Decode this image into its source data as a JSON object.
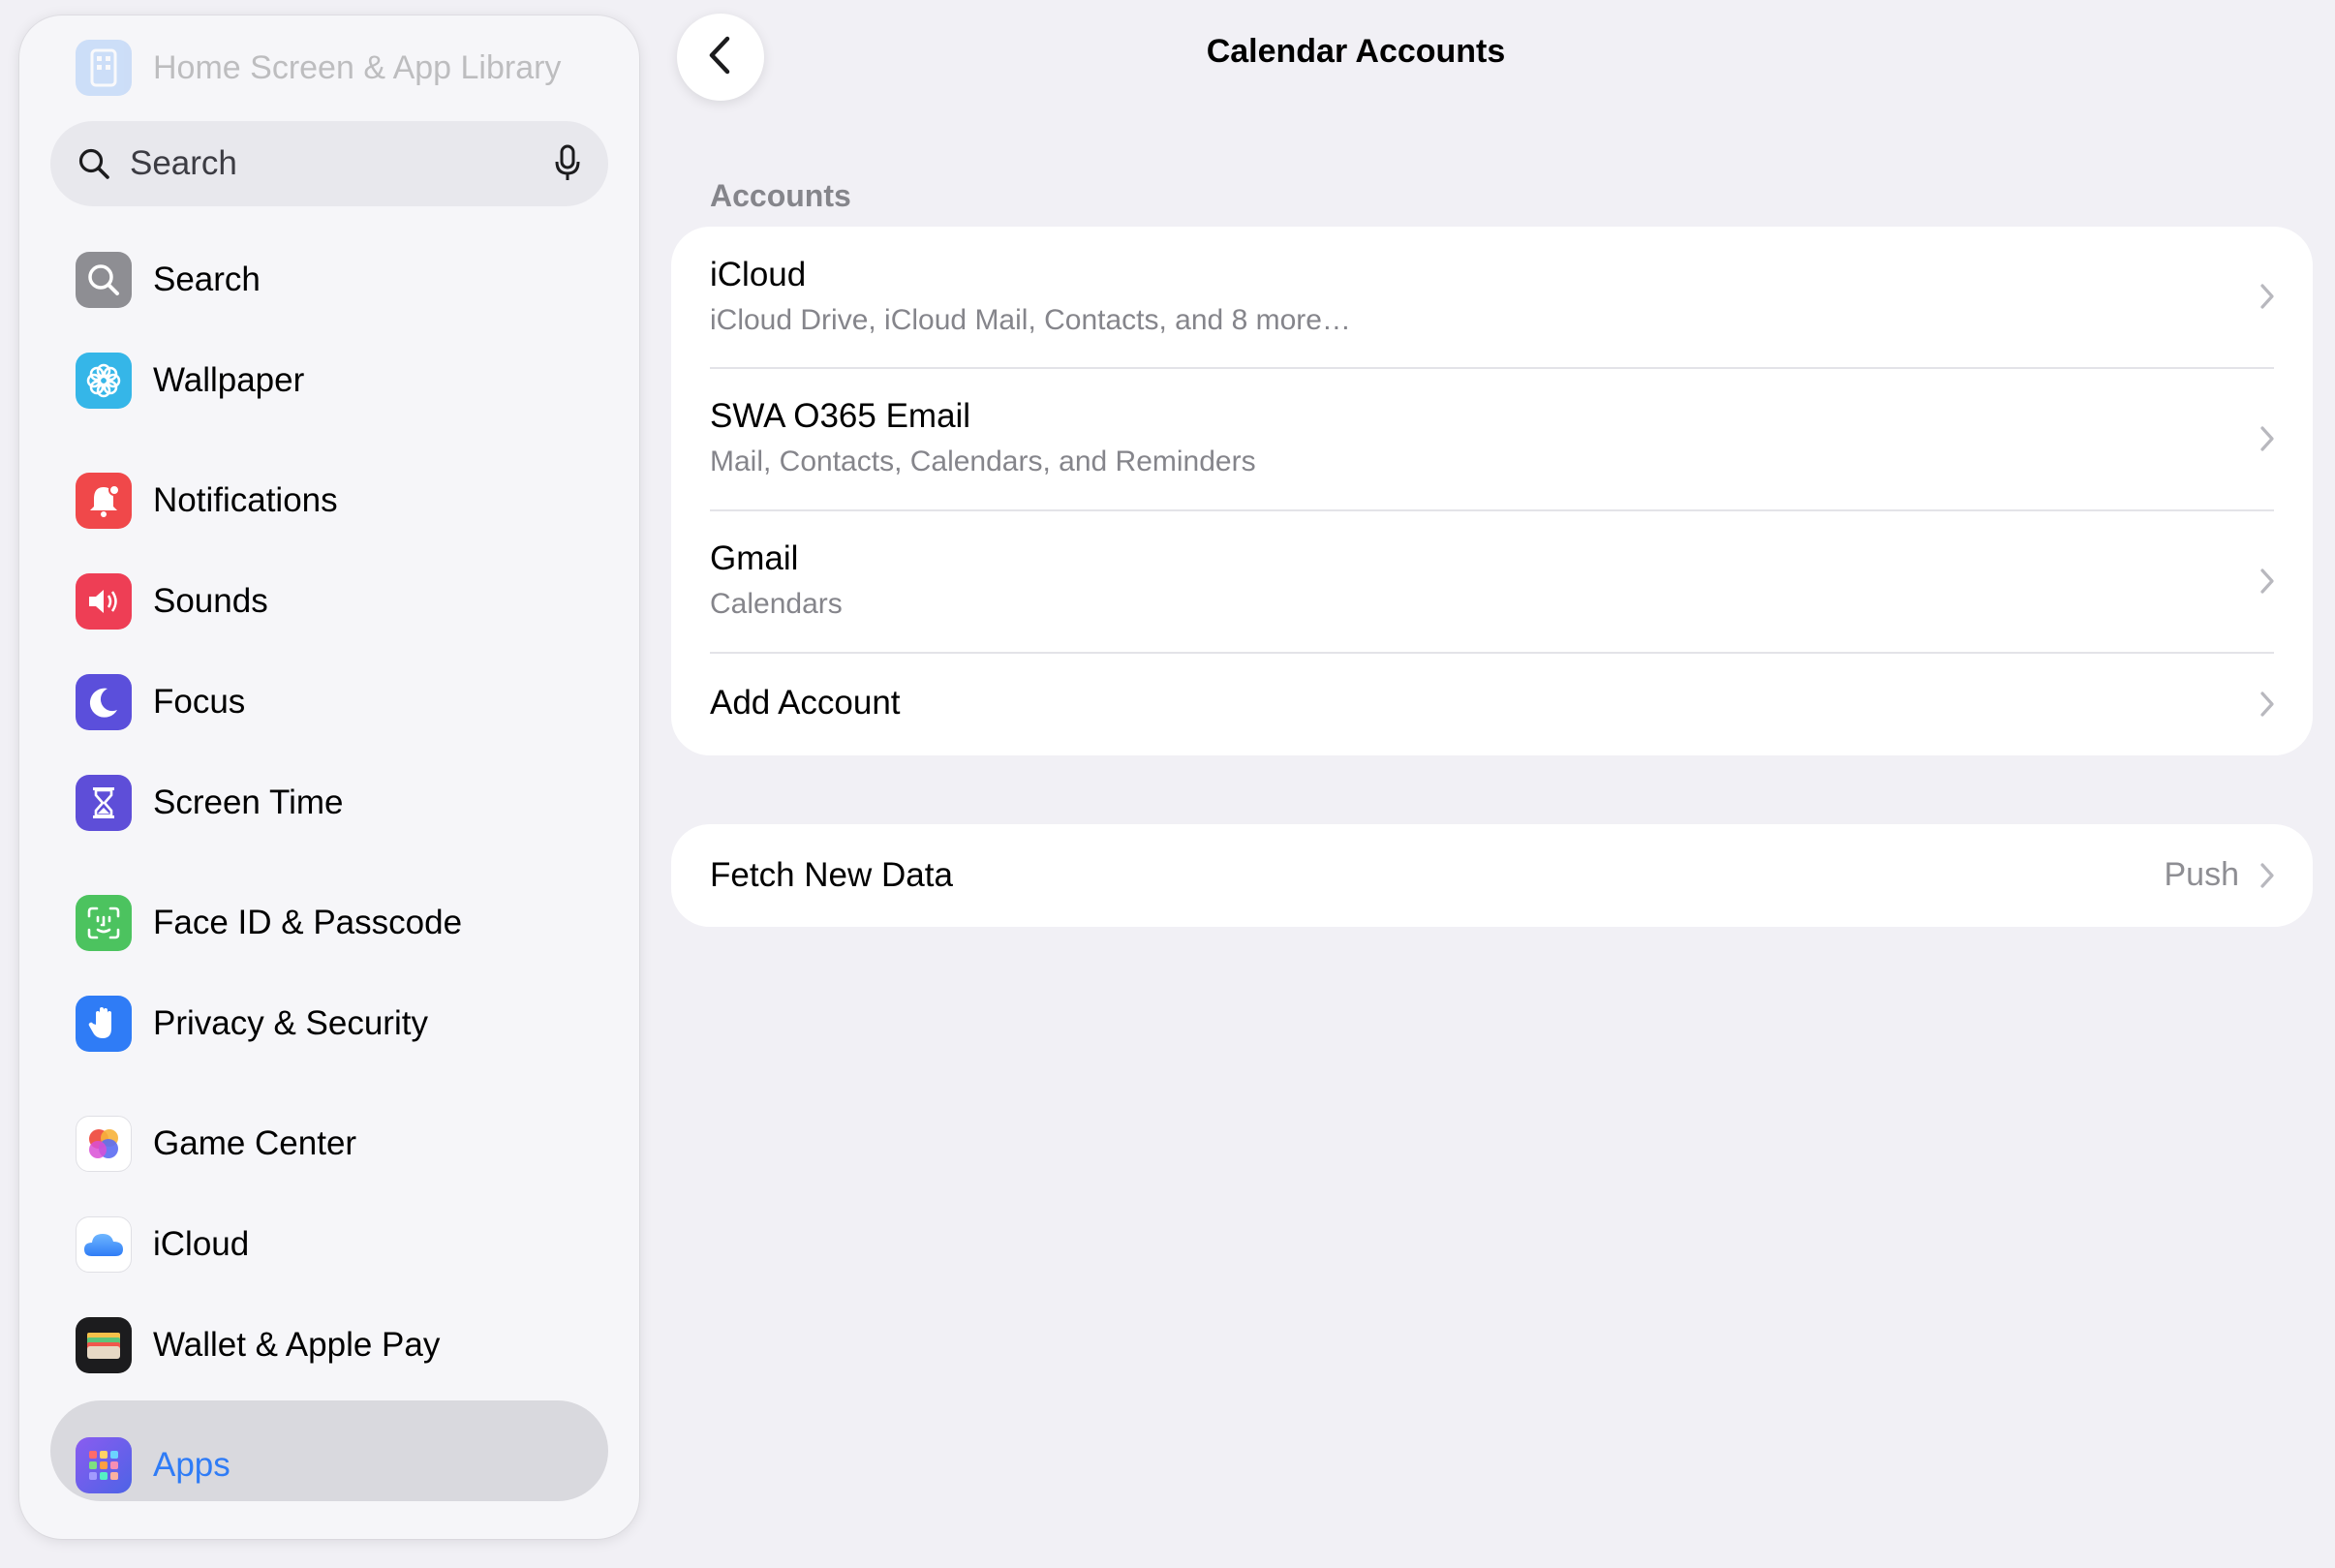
{
  "sidebar": {
    "top_item": {
      "label": "Home Screen & App Library",
      "icon": "home-screen-icon"
    },
    "search": {
      "placeholder": "Search",
      "icon": "magnifier-icon",
      "mic_icon": "microphone-icon"
    },
    "items": [
      {
        "label": "Search",
        "icon": "search-app-icon",
        "color": "#8e8e93"
      },
      {
        "label": "Wallpaper",
        "icon": "wallpaper-flower-icon",
        "color": "#35b6e8"
      },
      {
        "label": "Notifications",
        "icon": "bell-icon",
        "color": "#f0484a"
      },
      {
        "label": "Sounds",
        "icon": "speaker-icon",
        "color": "#ee3e55"
      },
      {
        "label": "Focus",
        "icon": "moon-icon",
        "color": "#5b4fdb"
      },
      {
        "label": "Screen Time",
        "icon": "hourglass-icon",
        "color": "#5e4ed8"
      },
      {
        "label": "Face ID & Passcode",
        "icon": "face-id-icon",
        "color": "#4cc35f"
      },
      {
        "label": "Privacy & Security",
        "icon": "hand-icon",
        "color": "#2f7cf6"
      },
      {
        "label": "Game Center",
        "icon": "game-center-icon",
        "color": "#ffffff"
      },
      {
        "label": "iCloud",
        "icon": "cloud-icon",
        "color": "#ffffff"
      },
      {
        "label": "Wallet & Apple Pay",
        "icon": "wallet-icon",
        "color": "#1c1c1e"
      },
      {
        "label": "Apps",
        "icon": "apps-grid-icon",
        "color": "#6a4fe0",
        "selected": true
      }
    ]
  },
  "nav": {
    "back_icon": "chevron-left-icon",
    "title": "Calendar Accounts"
  },
  "accounts_section": {
    "header": "Accounts",
    "rows": [
      {
        "title": "iCloud",
        "subtitle": "iCloud Drive, iCloud Mail, Contacts, and 8 more…"
      },
      {
        "title": "SWA O365 Email",
        "subtitle": "Mail, Contacts, Calendars, and Reminders"
      },
      {
        "title": "Gmail",
        "subtitle": "Calendars"
      },
      {
        "title": "Add Account",
        "subtitle": ""
      }
    ]
  },
  "fetch_section": {
    "title": "Fetch New Data",
    "value": "Push"
  },
  "colors": {
    "accent": "#2f7cf6",
    "background": "#f1f0f5",
    "card": "#ffffff",
    "secondary_text": "#85858b"
  }
}
